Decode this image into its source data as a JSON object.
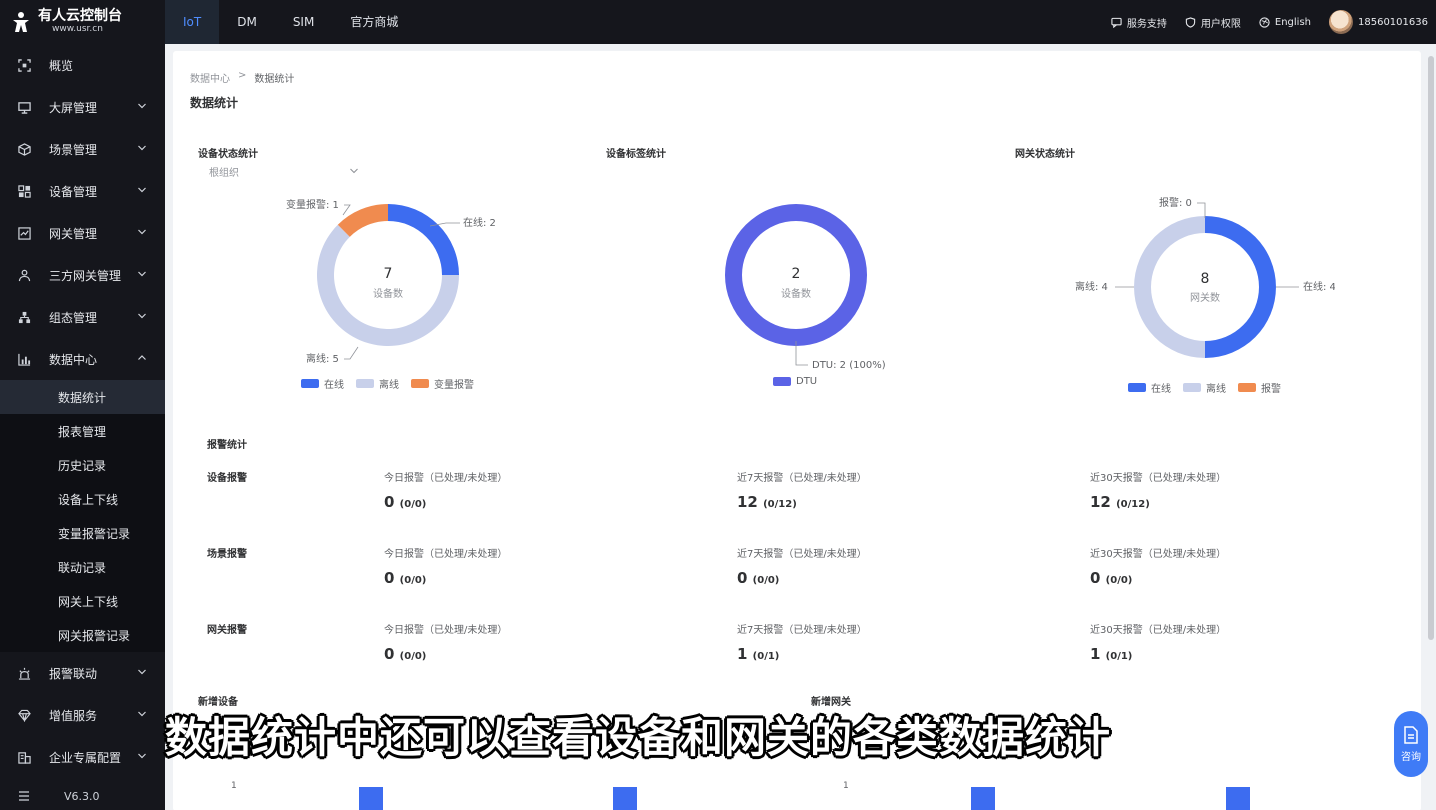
{
  "brand": {
    "title": "有人云控制台",
    "subtitle": "www.usr.cn"
  },
  "topnav": [
    {
      "label": "IoT",
      "active": true
    },
    {
      "label": "DM"
    },
    {
      "label": "SIM"
    },
    {
      "label": "官方商城"
    }
  ],
  "topright": {
    "support": "服务支持",
    "permissions": "用户权限",
    "language": "English",
    "phone": "18560101636"
  },
  "sidebar": {
    "items": [
      {
        "label": "概览",
        "icon": "overview-icon"
      },
      {
        "label": "大屏管理",
        "icon": "screen-icon"
      },
      {
        "label": "场景管理",
        "icon": "scene-icon"
      },
      {
        "label": "设备管理",
        "icon": "device-icon"
      },
      {
        "label": "网关管理",
        "icon": "gateway-icon"
      },
      {
        "label": "三方网关管理",
        "icon": "third-party-icon"
      },
      {
        "label": "组态管理",
        "icon": "config-icon"
      },
      {
        "label": "数据中心",
        "icon": "chart-icon"
      }
    ],
    "sub": [
      "数据统计",
      "报表管理",
      "历史记录",
      "设备上下线",
      "变量报警记录",
      "联动记录",
      "网关上下线",
      "网关报警记录"
    ],
    "items2": [
      {
        "label": "报警联动",
        "icon": "alarm-icon"
      },
      {
        "label": "增值服务",
        "icon": "gem-icon"
      },
      {
        "label": "企业专属配置",
        "icon": "enterprise-icon"
      }
    ],
    "version": "V6.3.0"
  },
  "breadcrumb": {
    "parent": "数据中心",
    "sep": ">",
    "current": "数据统计"
  },
  "page_title": "数据统计",
  "panels": {
    "device_status": {
      "title": "设备状态统计",
      "select": "根组织",
      "total": "7",
      "total_label": "设备数",
      "labels": {
        "online": "在线: 2",
        "offline": "离线: 5",
        "alarm": "变量报警: 1"
      },
      "legend": [
        "在线",
        "离线",
        "变量报警"
      ]
    },
    "device_tag": {
      "title": "设备标签统计",
      "total": "2",
      "total_label": "设备数",
      "label": "DTU: 2 (100%)",
      "legend": [
        "DTU"
      ]
    },
    "gateway_status": {
      "title": "网关状态统计",
      "total": "8",
      "total_label": "网关数",
      "labels": {
        "alarm": "报警: 0",
        "offline": "离线: 4",
        "online": "在线: 4"
      },
      "legend": [
        "在线",
        "离线",
        "报警"
      ]
    }
  },
  "chart_data": [
    {
      "type": "pie",
      "title": "设备状态统计",
      "categories": [
        "在线",
        "离线",
        "变量报警"
      ],
      "values": [
        2,
        5,
        1
      ],
      "colors": [
        "#3d6cf0",
        "#c8d0ea",
        "#f08b4f"
      ]
    },
    {
      "type": "pie",
      "title": "设备标签统计",
      "categories": [
        "DTU"
      ],
      "values": [
        2
      ],
      "colors": [
        "#5b63e6"
      ]
    },
    {
      "type": "pie",
      "title": "网关状态统计",
      "categories": [
        "在线",
        "离线",
        "报警"
      ],
      "values": [
        4,
        4,
        0
      ],
      "colors": [
        "#3d6cf0",
        "#c8d0ea",
        "#f08b4f"
      ]
    }
  ],
  "alarm_stats": {
    "title": "报警统计",
    "col_labels": [
      "今日报警（已处理/未处理）",
      "近7天报警（已处理/未处理）",
      "近30天报警（已处理/未处理）"
    ],
    "rows": [
      {
        "label": "设备报警",
        "values": [
          {
            "main": "0",
            "sub": "(0/0)"
          },
          {
            "main": "12",
            "sub": "(0/12)"
          },
          {
            "main": "12",
            "sub": "(0/12)"
          }
        ]
      },
      {
        "label": "场景报警",
        "values": [
          {
            "main": "0",
            "sub": "(0/0)"
          },
          {
            "main": "0",
            "sub": "(0/0)"
          },
          {
            "main": "0",
            "sub": "(0/0)"
          }
        ]
      },
      {
        "label": "网关报警",
        "values": [
          {
            "main": "0",
            "sub": "(0/0)"
          },
          {
            "main": "1",
            "sub": "(0/1)"
          },
          {
            "main": "1",
            "sub": "(0/1)"
          }
        ]
      }
    ]
  },
  "bottom": {
    "left_title": "新增设备",
    "right_title": "新增网关",
    "tick": "1"
  },
  "caption": "数据统计中还可以查看设备和网关的各类数据统计",
  "consult": "咨询",
  "colors": {
    "online": "#3d6cf0",
    "offline": "#c8d0ea",
    "alarm": "#f08b4f",
    "dtu": "#5b63e6",
    "accent": "#4f8dff"
  }
}
